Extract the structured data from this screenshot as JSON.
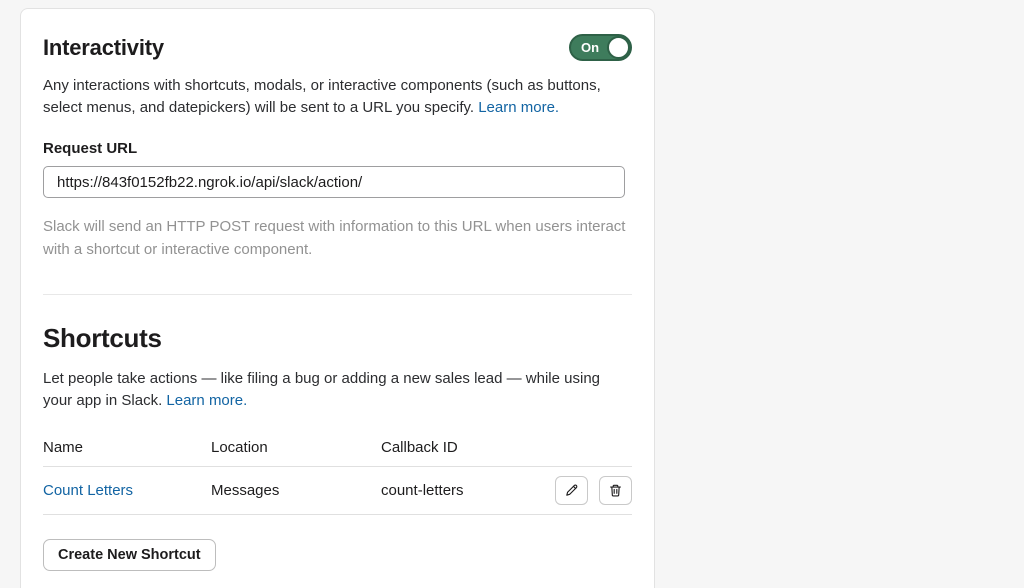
{
  "interactivity": {
    "title": "Interactivity",
    "toggle": {
      "state": "On",
      "enabled": true
    },
    "description": "Any interactions with shortcuts, modals, or interactive components (such as buttons, select menus, and datepickers) will be sent to a URL you specify.",
    "learn_more_label": "Learn more.",
    "request_url": {
      "label": "Request URL",
      "value": "https://843f0152fb22.ngrok.io/api/slack/action/",
      "help": "Slack will send an HTTP POST request with information to this URL when users interact with a shortcut or interactive component."
    }
  },
  "shortcuts": {
    "title": "Shortcuts",
    "description": "Let people take actions — like filing a bug or adding a new sales lead — while using your app in Slack.",
    "learn_more_label": "Learn more.",
    "table": {
      "headers": [
        "Name",
        "Location",
        "Callback ID"
      ],
      "rows": [
        {
          "name": "Count Letters",
          "location": "Messages",
          "callback_id": "count-letters"
        }
      ]
    },
    "create_button_label": "Create New Shortcut"
  },
  "icons": {
    "edit": "pencil-icon",
    "delete": "trash-icon"
  },
  "colors": {
    "toggle_green": "#3e7c5c",
    "toggle_green_border": "#2e6147",
    "link_blue": "#1264a3",
    "page_background": "#f6f6f6"
  }
}
